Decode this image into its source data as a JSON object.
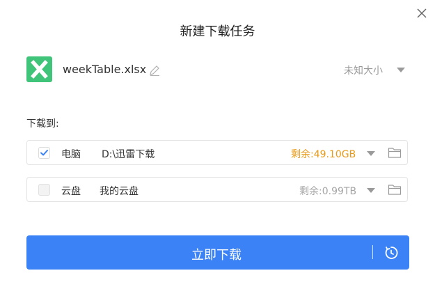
{
  "dialog": {
    "title": "新建下载任务",
    "close_icon": "close-icon"
  },
  "file": {
    "icon": "excel-file-icon",
    "icon_color": "#40c47a",
    "name": "weekTable.xlsx",
    "size_label": "未知大小"
  },
  "section": {
    "label": "下载到:"
  },
  "targets": [
    {
      "name": "电脑",
      "path": "D:\\迅雷下载",
      "free": "剩余:49.10GB",
      "checked": true,
      "free_color": "#e89a17"
    },
    {
      "name": "云盘",
      "path": "我的云盘",
      "free": "剩余:0.99TB",
      "checked": false,
      "free_color": "#a5a5a5"
    }
  ],
  "download_button": {
    "label": "立即下载",
    "color": "#3b82f6",
    "schedule_icon": "schedule-clock-icon"
  }
}
